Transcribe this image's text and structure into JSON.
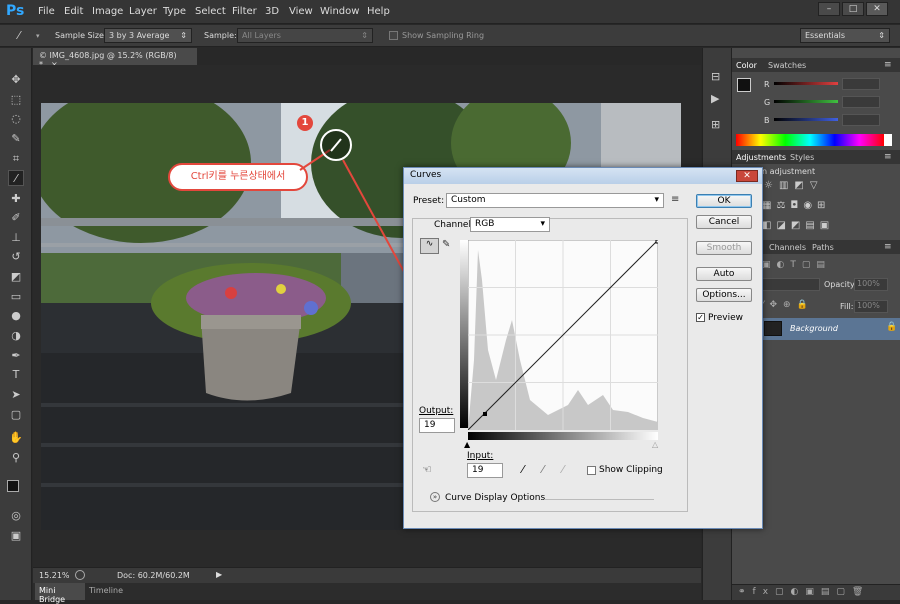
{
  "app": {
    "logo": "Ps"
  },
  "menu": [
    "File",
    "Edit",
    "Image",
    "Layer",
    "Type",
    "Select",
    "Filter",
    "3D",
    "View",
    "Window",
    "Help"
  ],
  "options": {
    "sample_size_label": "Sample Size:",
    "sample_size_value": "3 by 3 Average",
    "sample_label": "Sample:",
    "sample_value": "All Layers",
    "sampling_ring_label": "Show Sampling Ring",
    "workspace": "Essentials"
  },
  "document": {
    "tab_title": "© IMG_4608.jpg @ 15.2% (RGB/8) *",
    "zoom": "15.21%",
    "doc_size": "Doc: 60.2M/60.2M"
  },
  "bottom_tabs": [
    "Mini Bridge",
    "Timeline"
  ],
  "callout": {
    "badge": "1",
    "text": "Ctrl키를 누른상태에서"
  },
  "curves": {
    "title": "Curves",
    "preset_label": "Preset:",
    "preset_value": "Custom",
    "channel_label": "Channel:",
    "channel_value": "RGB",
    "output_label": "Output:",
    "output_value": "19",
    "input_label": "Input:",
    "input_value": "19",
    "show_clipping": "Show Clipping",
    "display_options": "Curve Display Options",
    "buttons": {
      "ok": "OK",
      "cancel": "Cancel",
      "smooth": "Smooth",
      "auto": "Auto",
      "options": "Options..."
    },
    "preview_label": "Preview",
    "preview_checked": true
  },
  "color_panel": {
    "tabs": [
      "Color",
      "Swatches"
    ],
    "channels": [
      {
        "label": "R",
        "value": "",
        "color": "#e04040"
      },
      {
        "label": "G",
        "value": "",
        "color": "#40c040"
      },
      {
        "label": "B",
        "value": "",
        "color": "#4060e0"
      }
    ]
  },
  "adjustments_panel": {
    "tabs": [
      "Adjustments",
      "Styles"
    ],
    "title": "n adjustment"
  },
  "layers_panel": {
    "tabs": [
      "Channels",
      "Paths"
    ],
    "opacity_label": "Opacity:",
    "opacity_value": "100%",
    "fill_label": "Fill:",
    "fill_value": "100%",
    "layer_name": "Background"
  }
}
